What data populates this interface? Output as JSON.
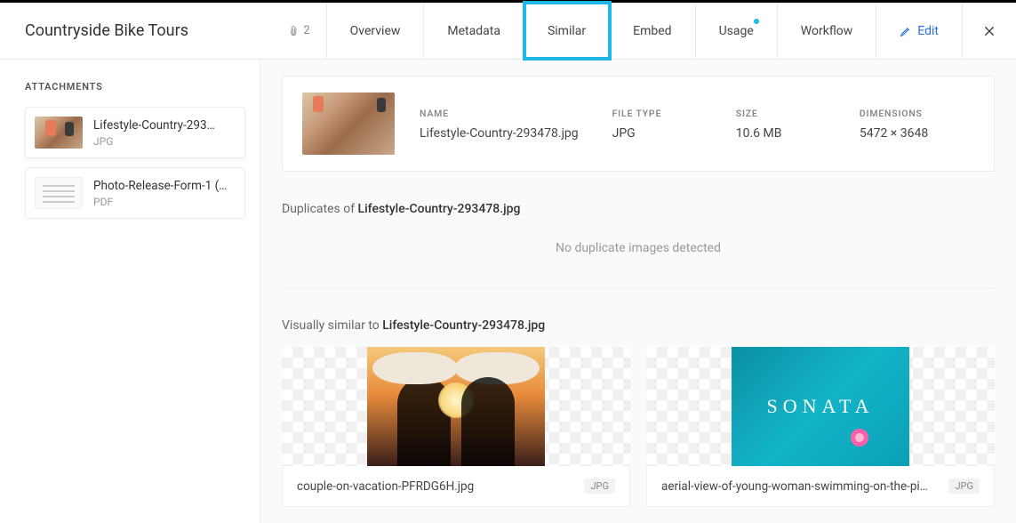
{
  "header": {
    "title": "Countryside Bike Tours",
    "attachment_count": "2",
    "tabs": [
      {
        "label": "Overview"
      },
      {
        "label": "Metadata"
      },
      {
        "label": "Similar",
        "active": true
      },
      {
        "label": "Embed"
      },
      {
        "label": "Usage",
        "has_dot": true
      },
      {
        "label": "Workflow"
      },
      {
        "label": "Edit",
        "is_edit": true
      }
    ]
  },
  "sidebar": {
    "heading": "ATTACHMENTS",
    "items": [
      {
        "name": "Lifestyle-Country-293…",
        "type": "JPG",
        "thumb": "bike",
        "selected": true
      },
      {
        "name": "Photo-Release-Form-1 (…",
        "type": "PDF",
        "thumb": "doc",
        "selected": false
      }
    ]
  },
  "filecard": {
    "labels": {
      "name": "NAME",
      "file_type": "FILE TYPE",
      "size": "SIZE",
      "dimensions": "DIMENSIONS"
    },
    "values": {
      "name": "Lifestyle-Country-293478.jpg",
      "file_type": "JPG",
      "size": "10.6 MB",
      "dimensions": "5472 × 3648"
    }
  },
  "duplicates": {
    "prefix": "Duplicates of ",
    "filename": "Lifestyle-Country-293478.jpg",
    "empty_text": "No duplicate images detected"
  },
  "similar": {
    "prefix": "Visually similar to ",
    "filename": "Lifestyle-Country-293478.jpg",
    "brand_overlay": "SONATA",
    "items": [
      {
        "name": "couple-on-vacation-PFRDG6H.jpg",
        "type": "JPG"
      },
      {
        "name": "aerial-view-of-young-woman-swimming-on-the-pi…",
        "type": "JPG"
      }
    ]
  }
}
